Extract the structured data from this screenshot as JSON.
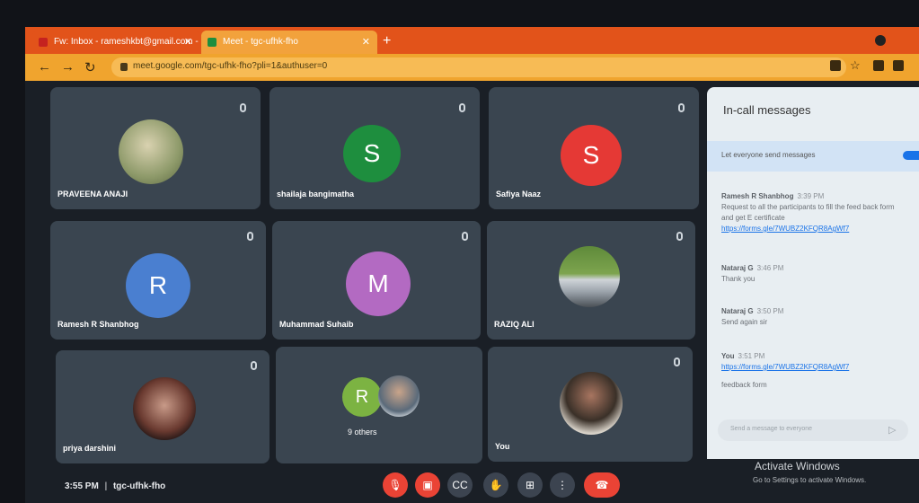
{
  "browser": {
    "tabs": [
      {
        "label": "Fw: Inbox - rameshkbt@gmail.com - Jan"
      },
      {
        "label": "Meet - tgc-ufhk-fho"
      }
    ],
    "url": "meet.google.com/tgc-ufhk-fho?pli=1&authuser=0"
  },
  "tiles": [
    {
      "name": "PRAVEENA ANAJI",
      "type": "photo"
    },
    {
      "name": "shailaja bangimatha",
      "initial": "S",
      "color": "#1e8e3e"
    },
    {
      "name": "Safiya Naaz",
      "initial": "S",
      "color": "#e53935"
    },
    {
      "name": "Ramesh R Shanbhog",
      "initial": "R",
      "color": "#4a7fd0"
    },
    {
      "name": "Muhammad Suhaib",
      "initial": "M",
      "color": "#b36ac2"
    },
    {
      "name": "RAZIQ ALI",
      "type": "photo"
    },
    {
      "name": "priya darshini",
      "type": "photo"
    },
    {
      "name": "9 others",
      "initial": "R",
      "color": "#7cb342"
    },
    {
      "name": "You",
      "type": "photo"
    }
  ],
  "panel": {
    "title": "In-call messages",
    "toggle_label": "Let everyone send messages",
    "messages": [
      {
        "sender": "Ramesh R Shanbhog",
        "time": "3:39 PM",
        "text": "Request to all the participants to fill the feed back form and get E certificate",
        "link": "https://forms.gle/7WUBZ2KFQR8AgWf7"
      },
      {
        "sender": "Nataraj G",
        "time": "3:46 PM",
        "text": "Thank you"
      },
      {
        "sender": "Nataraj G",
        "time": "3:50 PM",
        "text": "Send again sir"
      },
      {
        "sender": "You",
        "time": "3:51 PM",
        "link": "https://forms.gle/7WUBZ2KFQR8AgWf7",
        "text": "feedback form"
      }
    ],
    "send_placeholder": "Send a message to everyone"
  },
  "bottom": {
    "time": "3:55 PM",
    "meeting_code": "tgc-ufhk-fho",
    "separator": "|"
  },
  "watermark": {
    "title": "Activate Windows",
    "subtitle": "Go to Settings to activate Windows."
  },
  "colors": {
    "tab_bar": "#e2531a",
    "address_bar": "#f0a42e",
    "end_call": "#ea4335",
    "tile_bg": "#3a4550"
  },
  "icons": {
    "controls": [
      "mic-off-icon",
      "camera-off-icon",
      "captions-icon",
      "raise-hand-icon",
      "present-icon",
      "more-icon",
      "end-call-icon"
    ]
  }
}
